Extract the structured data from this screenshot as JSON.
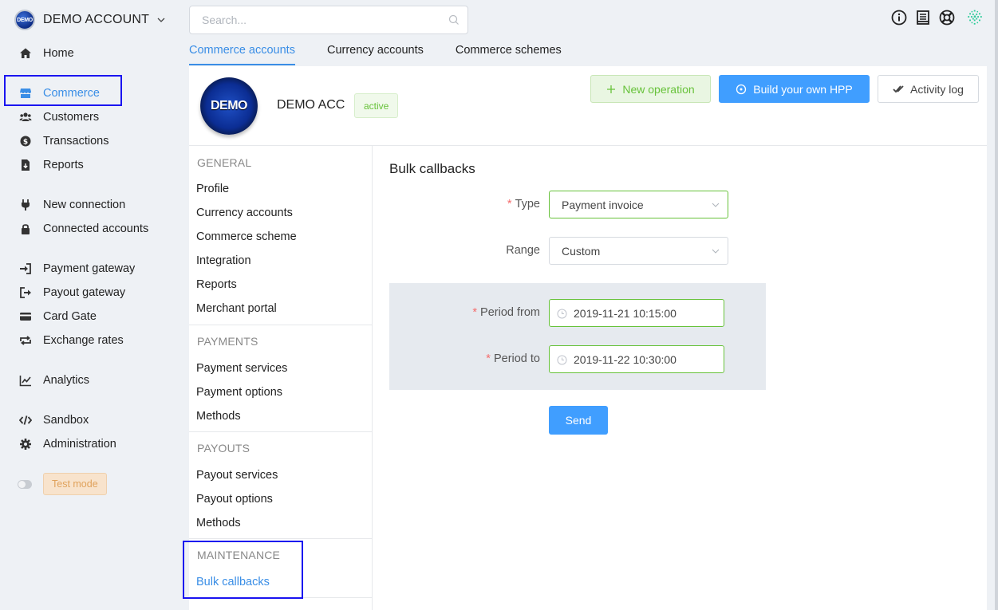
{
  "account": {
    "logo_text": "DEMO",
    "name": "DEMO ACCOUNT"
  },
  "sidebar": {
    "items": [
      {
        "label": "Home",
        "icon": "home-icon"
      },
      {
        "label": "Commerce",
        "icon": "store-icon"
      },
      {
        "label": "Customers",
        "icon": "users-icon"
      },
      {
        "label": "Transactions",
        "icon": "dollar-icon"
      },
      {
        "label": "Reports",
        "icon": "report-icon"
      },
      {
        "label": "New connection",
        "icon": "plug-icon"
      },
      {
        "label": "Connected accounts",
        "icon": "lock-icon"
      },
      {
        "label": "Payment gateway",
        "icon": "sign-in-icon"
      },
      {
        "label": "Payout gateway",
        "icon": "sign-out-icon"
      },
      {
        "label": "Card Gate",
        "icon": "card-icon"
      },
      {
        "label": "Exchange rates",
        "icon": "exchange-icon"
      },
      {
        "label": "Analytics",
        "icon": "chart-line-icon"
      },
      {
        "label": "Sandbox",
        "icon": "code-icon"
      },
      {
        "label": "Administration",
        "icon": "gear-icon"
      }
    ],
    "test_mode_label": "Test mode"
  },
  "search": {
    "placeholder": "Search..."
  },
  "tabs": [
    {
      "label": "Commerce accounts"
    },
    {
      "label": "Currency accounts"
    },
    {
      "label": "Commerce schemes"
    }
  ],
  "header": {
    "logo_text": "DEMO",
    "title": "DEMO ACC",
    "status": "active",
    "new_operation": "New operation",
    "build_hpp": "Build your own HPP",
    "activity_log": "Activity log"
  },
  "subnav": {
    "general": {
      "title": "GENERAL",
      "links": [
        "Profile",
        "Currency accounts",
        "Commerce scheme",
        "Integration",
        "Reports",
        "Merchant portal"
      ]
    },
    "payments": {
      "title": "PAYMENTS",
      "links": [
        "Payment services",
        "Payment options",
        "Methods"
      ]
    },
    "payouts": {
      "title": "PAYOUTS",
      "links": [
        "Payout services",
        "Payout options",
        "Methods"
      ]
    },
    "maintenance": {
      "title": "MAINTENANCE",
      "links": [
        "Bulk callbacks"
      ]
    }
  },
  "form": {
    "title": "Bulk callbacks",
    "type_label": "Type",
    "type_value": "Payment invoice",
    "range_label": "Range",
    "range_value": "Custom",
    "period_from_label": "Period from",
    "period_from_value": "2019-11-21 10:15:00",
    "period_to_label": "Period to",
    "period_to_value": "2019-11-22 10:30:00",
    "send_label": "Send"
  },
  "colors": {
    "accent": "#3a8ee6",
    "primary_button": "#409eff",
    "success": "#67c23a",
    "required": "#f56c6c",
    "highlight": "#1a14f0"
  }
}
